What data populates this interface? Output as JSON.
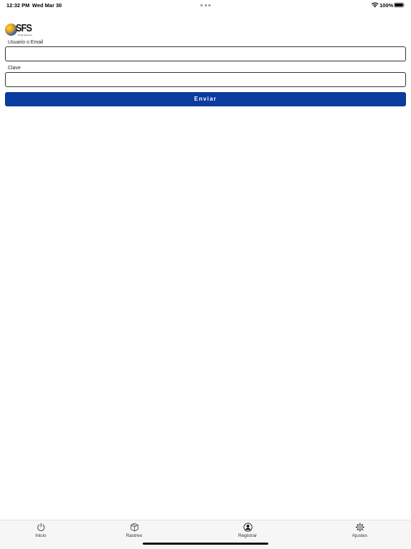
{
  "status_bar": {
    "time": "12:32 PM",
    "date": "Wed Mar 30",
    "battery": "100%"
  },
  "logo": {
    "text": "SFS",
    "subtext": "Cargo Express"
  },
  "form": {
    "user_label": "Usuario o Email",
    "user_value": "",
    "password_label": "Clave",
    "password_value": "",
    "submit_label": "Enviar",
    "submit_color": "#0a3b9e"
  },
  "tab_bar": {
    "items": [
      {
        "label": "Inicio",
        "icon": "power-icon"
      },
      {
        "label": "Rastreo",
        "icon": "package-icon"
      },
      {
        "label": "Registrar",
        "icon": "user-circle-icon"
      },
      {
        "label": "Ajustes",
        "icon": "gear-icon"
      }
    ]
  }
}
